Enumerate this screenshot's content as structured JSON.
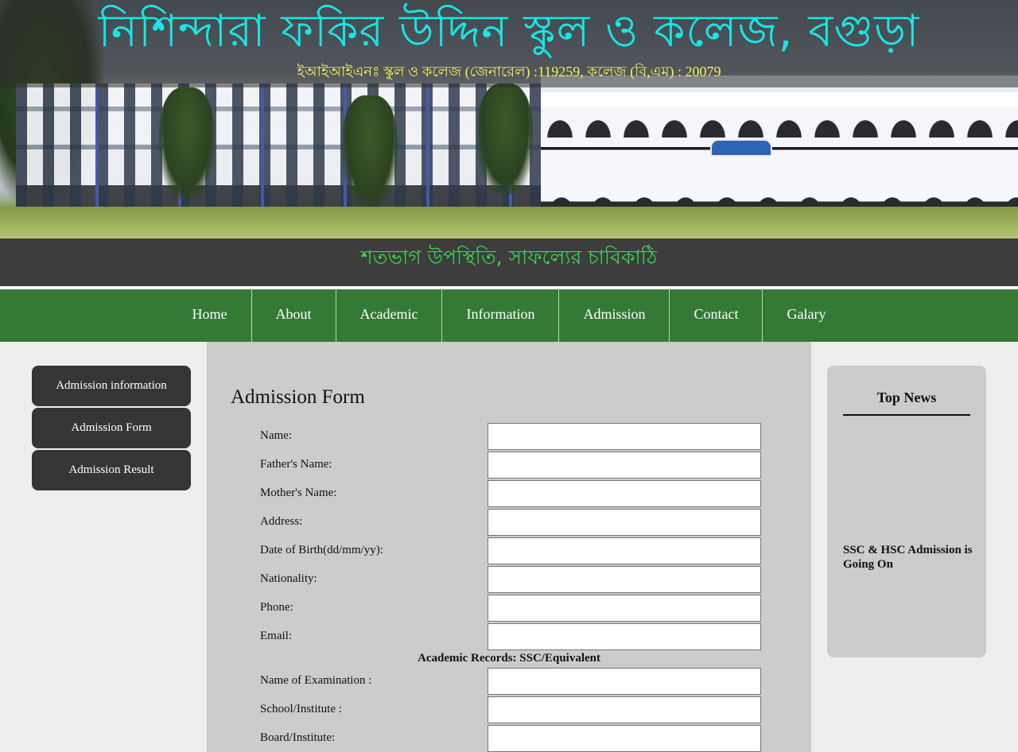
{
  "header": {
    "site_title": "নিশিন্দারা ফকির উদ্দিন স্কুল ও কলেজ, বগুড়া",
    "eiin_line": "ইআইআইএনঃ স্কুল ও কলেজ (জেনারেল) :119259, কলেজ (বি,এম) : 20079",
    "motto": "শতভাগ উপস্থিতি, সাফল্যের চাবিকাঠি"
  },
  "nav": {
    "items": [
      {
        "label": "Home"
      },
      {
        "label": "About"
      },
      {
        "label": "Academic"
      },
      {
        "label": "Information"
      },
      {
        "label": "Admission"
      },
      {
        "label": "Contact"
      },
      {
        "label": "Galary"
      }
    ]
  },
  "sidebar": {
    "items": [
      {
        "label": "Admission information"
      },
      {
        "label": "Admission Form"
      },
      {
        "label": "Admission Result"
      }
    ]
  },
  "form": {
    "title": "Admission Form",
    "fields": [
      {
        "label": "Name:",
        "value": ""
      },
      {
        "label": "Father's Name:",
        "value": ""
      },
      {
        "label": "Mother's Name:",
        "value": ""
      },
      {
        "label": "Address:",
        "value": ""
      },
      {
        "label": "Date of Birth(dd/mm/yy):",
        "value": ""
      },
      {
        "label": "Nationality:",
        "value": ""
      },
      {
        "label": "Phone:",
        "value": ""
      },
      {
        "label": "Email:",
        "value": ""
      }
    ],
    "academic_heading": "Academic Records: SSC/Equivalent",
    "academic_fields": [
      {
        "label": "Name of Examination :",
        "value": ""
      },
      {
        "label": "School/Institute :",
        "value": ""
      },
      {
        "label": "Board/Institute:",
        "value": ""
      }
    ]
  },
  "news": {
    "heading": "Top News",
    "items": [
      {
        "text": "SSC & HSC Admission is Going On"
      }
    ]
  },
  "colors": {
    "title": "#18e6e6",
    "eiin": "#f7f05b",
    "motto": "#2fdc49",
    "nav_bg": "#347a35",
    "sidebar_btn": "#353535",
    "panel_bg": "#cccccc"
  }
}
